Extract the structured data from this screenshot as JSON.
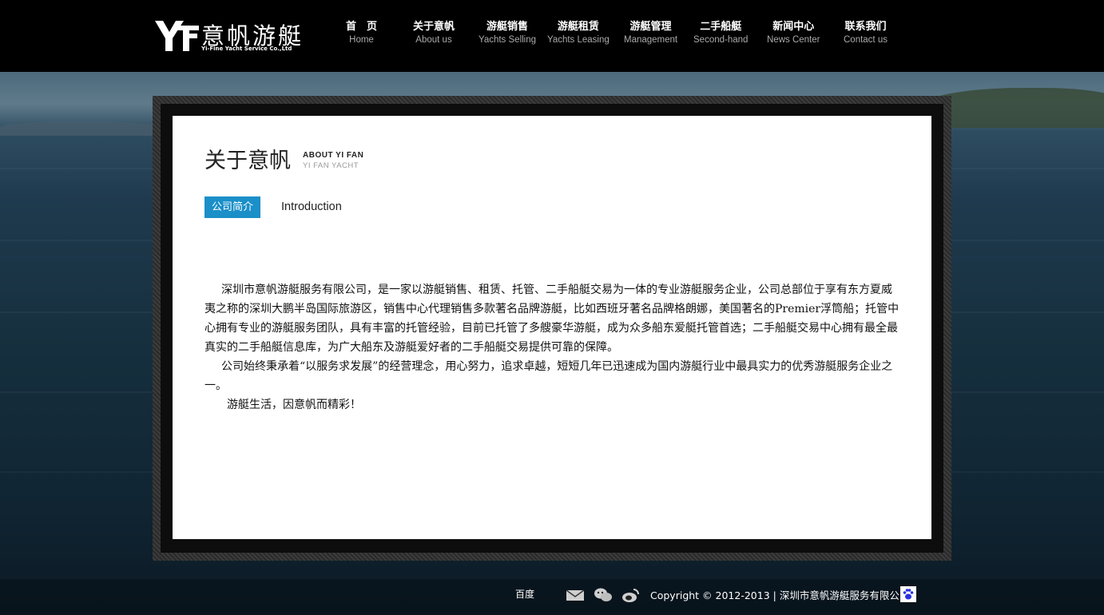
{
  "brand": {
    "name_cn": "意帆游艇",
    "name_en": "Yi-Fine Yacht Service Co.,Ltd"
  },
  "nav": [
    {
      "cn": "首　页",
      "en": "Home"
    },
    {
      "cn": "关于意帆",
      "en": "About us"
    },
    {
      "cn": "游艇销售",
      "en": "Yachts Selling"
    },
    {
      "cn": "游艇租赁",
      "en": "Yachts Leasing"
    },
    {
      "cn": "游艇管理",
      "en": "Management"
    },
    {
      "cn": "二手船艇",
      "en": "Second-hand"
    },
    {
      "cn": "新闻中心",
      "en": "News Center"
    },
    {
      "cn": "联系我们",
      "en": "Contact us"
    }
  ],
  "page": {
    "title_cn": "关于意帆",
    "title_en1": "ABOUT YI FAN",
    "title_en2": "YI FAN YACHT",
    "tab_active": "公司简介",
    "tab_label": "Introduction"
  },
  "content": {
    "p1": "深圳市意帆游艇服务有限公司，是一家以游艇销售、租赁、托管、二手船艇交易为一体的专业游艇服务企业，公司总部位于享有东方夏威夷之称的深圳大鹏半岛国际旅游区，销售中心代理销售多款著名品牌游艇，比如西班牙著名品牌格朗娜，美国著名的Premier浮筒船；托管中心拥有专业的游艇服务团队，具有丰富的托管经验，目前已托管了多艘豪华游艇，成为众多船东爱艇托管首选；二手船艇交易中心拥有最全最真实的二手船艇信息库，为广大船东及游艇爱好者的二手船艇交易提供可靠的保障。",
    "p2": "公司始终秉承着“以服务求发展”的经营理念，用心努力，追求卓越，短短几年已迅速成为国内游艇行业中最具实力的优秀游艇服务企业之一。",
    "p3": "游艇生活，因意帆而精彩！"
  },
  "footer": {
    "baidu": "百度",
    "copyright": "Copyright © 2012-2013 | 深圳市意帆游艇服务有限公司"
  },
  "colors": {
    "accent": "#1a8fc8",
    "header_bg": "#000000",
    "panel_bg": "#ffffff"
  }
}
